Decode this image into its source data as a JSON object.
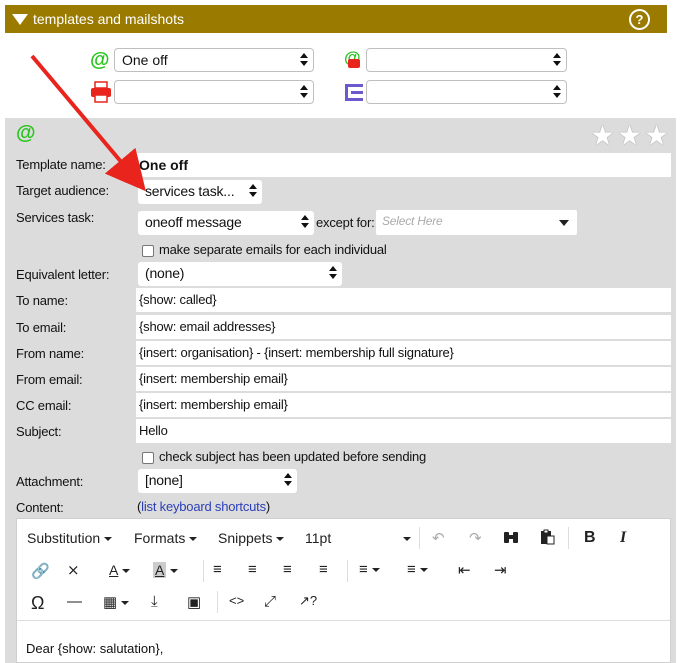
{
  "header": {
    "title": "templates and mailshots",
    "help_icon": "?"
  },
  "channels": {
    "email_select": "One off",
    "sms_select": "",
    "print_select": "",
    "letter_select": ""
  },
  "panel_icon": "@",
  "form": {
    "template_name_label": "Template name:",
    "template_name_value": "One off",
    "target_audience_label": "Target audience:",
    "target_audience_value": "services task...",
    "services_task_label": "Services task:",
    "services_task_value": "oneoff message",
    "except_for_label": "except for:",
    "except_for_placeholder": "Select Here",
    "separate_emails_label": "make separate emails for each individual",
    "equivalent_letter_label": "Equivalent letter:",
    "equivalent_letter_value": "(none)",
    "to_name_label": "To name:",
    "to_name_value": "{show: called}",
    "to_email_label": "To email:",
    "to_email_value": "{show: email addresses}",
    "from_name_label": "From name:",
    "from_name_value": "{insert: organisation} - {insert: membership full signature}",
    "from_email_label": "From email:",
    "from_email_value": "{insert: membership email}",
    "cc_email_label": "CC email:",
    "cc_email_value": "{insert: membership email}",
    "subject_label": "Subject:",
    "subject_value": "Hello",
    "check_subject_label": "check subject has been updated before sending",
    "attachment_label": "Attachment:",
    "attachment_value": "[none]",
    "content_label": "Content:",
    "content_open": "(",
    "shortcuts_link": "list keyboard shortcuts",
    "content_close": ")"
  },
  "toolbar": {
    "substitution": "Substitution",
    "formats": "Formats",
    "snippets": "Snippets",
    "font_size": "11pt",
    "bold": "B",
    "italic": "I"
  },
  "editor_content": "Dear {show: salutation},",
  "colors": {
    "header_bg": "#9b7a00",
    "panel_bg": "#dcdcdc",
    "accent_green": "#27c41d",
    "arrow_red": "#e8241d",
    "link": "#2b3fb8"
  }
}
